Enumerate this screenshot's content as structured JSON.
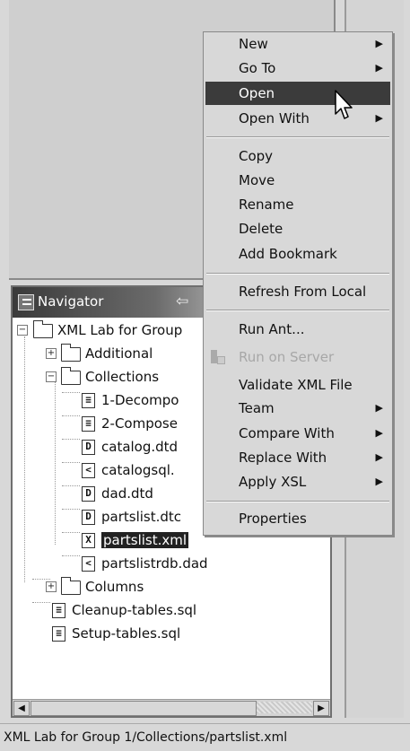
{
  "navigator": {
    "title": "Navigator",
    "tree": {
      "project": "XML Lab for Group",
      "folders": [
        "Additional",
        "Collections",
        "Columns"
      ],
      "collection_files": [
        {
          "name": "1-Decompo",
          "icon": "sql-file-icon"
        },
        {
          "name": "2-Compose",
          "icon": "sql-file-icon"
        },
        {
          "name": "catalog.dtd",
          "icon": "dtd-file-icon"
        },
        {
          "name": "catalogsql.",
          "icon": "dad-file-icon"
        },
        {
          "name": "dad.dtd",
          "icon": "dtd-file-icon"
        },
        {
          "name": "partslist.dtc",
          "icon": "dtd-file-icon"
        },
        {
          "name": "partslist.xml",
          "icon": "xml-file-icon"
        },
        {
          "name": "partslistrdb.dad",
          "icon": "dad-file-icon"
        }
      ],
      "root_files": [
        "Cleanup-tables.sql",
        "Setup-tables.sql"
      ],
      "selected": "partslist.xml"
    }
  },
  "context_menu": {
    "items": [
      {
        "label": "New",
        "submenu": true
      },
      {
        "label": "Go To",
        "submenu": true
      },
      {
        "label": "Open",
        "highlighted": true
      },
      {
        "label": "Open With",
        "submenu": true
      },
      {
        "label": "Copy"
      },
      {
        "label": "Move"
      },
      {
        "label": "Rename"
      },
      {
        "label": "Delete"
      },
      {
        "label": "Add Bookmark"
      },
      {
        "label": "Refresh From Local"
      },
      {
        "label": "Run Ant..."
      },
      {
        "label": "Run on Server",
        "disabled": true,
        "icon": "server-icon"
      },
      {
        "label": "Validate XML File"
      },
      {
        "label": "Team",
        "submenu": true
      },
      {
        "label": "Compare With",
        "submenu": true
      },
      {
        "label": "Replace With",
        "submenu": true
      },
      {
        "label": "Apply XSL",
        "submenu": true
      },
      {
        "label": "Properties"
      }
    ]
  },
  "icons": {
    "expand": "plus-expander-icon",
    "collapse": "minus-expander-icon",
    "folder": "folder-icon",
    "back": "back-arrow-icon",
    "submenu": "submenu-arrow-icon"
  },
  "status_bar": {
    "text": "XML Lab for Group 1/Collections/partslist.xml"
  },
  "colors": {
    "menu_highlight": "#3b3b3b",
    "selection": "#222222",
    "background": "#d8d8d8"
  }
}
